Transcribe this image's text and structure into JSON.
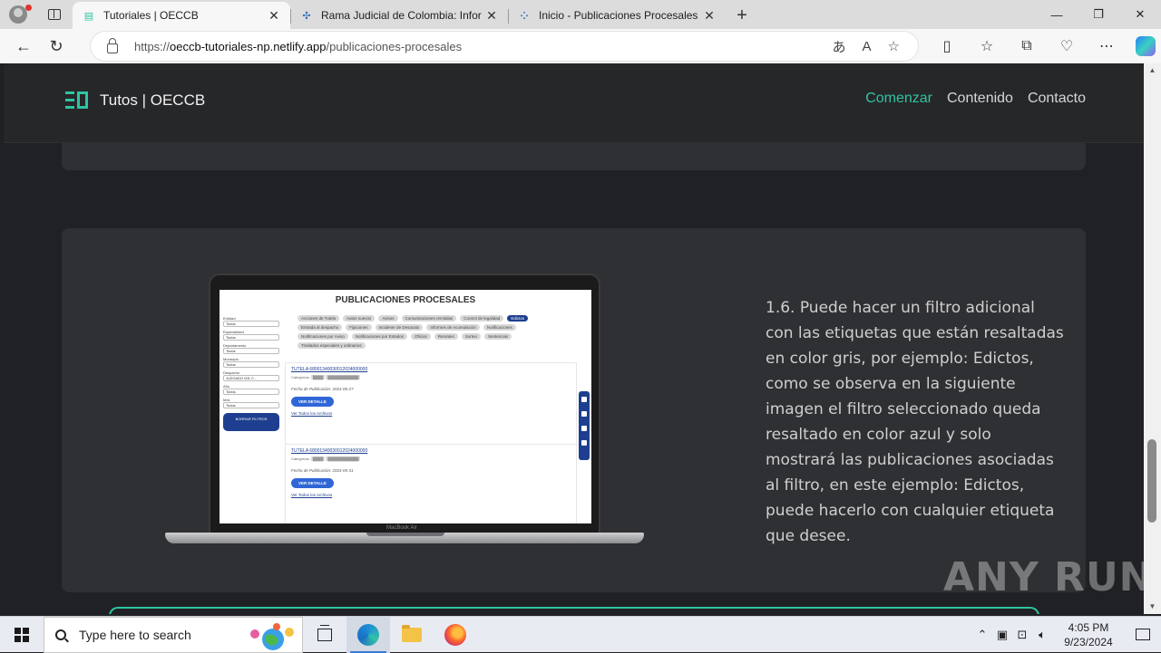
{
  "browser": {
    "tabs": [
      {
        "title": "Tutoriales | OECCB",
        "active": true,
        "favicon": "oeccb-logo-icon"
      },
      {
        "title": "Rama Judicial de Colombia: Infor",
        "active": false,
        "favicon": "rama-judicial-icon"
      },
      {
        "title": "Inicio - Publicaciones Procesales",
        "active": false,
        "favicon": "publicaciones-icon"
      }
    ],
    "url_prefix": "https://",
    "url_host": "oeccb-tutoriales-np.netlify.app",
    "url_path": "/publicaciones-procesales",
    "new_tab_glyph": "+"
  },
  "site": {
    "brand": "Tutos | OECCB",
    "nav": [
      {
        "label": "Comenzar",
        "active": true
      },
      {
        "label": "Contenido",
        "active": false
      },
      {
        "label": "Contacto",
        "active": false
      }
    ],
    "accent_color": "#2ec4a1"
  },
  "step": {
    "text": "1.6. Puede hacer un filtro adicional con las etiquetas que están resaltadas en color gris, por ejemplo: Edictos, como se observa en la siguiente imagen el filtro seleccionado queda resaltado en color azul y solo mostrará las publicaciones asociadas al filtro, en este ejemplo: Edictos, puede hacerlo con cualquier etiqueta que desee."
  },
  "screenshot": {
    "title": "PUBLICACIONES PROCESALES",
    "filters": [
      {
        "label": "Entidad",
        "value": "Todos"
      },
      {
        "label": "Especialidad",
        "value": "Todos"
      },
      {
        "label": "Departamento",
        "value": "Todos"
      },
      {
        "label": "Municipio",
        "value": "Todos"
      },
      {
        "label": "Despacho",
        "value": "JUZGADO 001 C..."
      },
      {
        "label": "Año",
        "value": "Todos"
      },
      {
        "label": "Mes",
        "value": "Todos"
      }
    ],
    "clear_button": "BORRAR FILTROS",
    "tags": [
      {
        "label": "Acciones de Tutela",
        "selected": false
      },
      {
        "label": "Autos nuevos",
        "selected": false
      },
      {
        "label": "Avisos",
        "selected": false
      },
      {
        "label": "Comunicaciones remitidas",
        "selected": false
      },
      {
        "label": "Control de legalidad",
        "selected": false
      },
      {
        "label": "Edictos",
        "selected": true
      },
      {
        "label": "Entrada al despacho",
        "selected": false
      },
      {
        "label": "Fijaciones",
        "selected": false
      },
      {
        "label": "Incidente de Desacato",
        "selected": false
      },
      {
        "label": "Informes de Acumulación",
        "selected": false
      },
      {
        "label": "Notificaciones",
        "selected": false
      },
      {
        "label": "Notificaciones por Aviso",
        "selected": false
      },
      {
        "label": "Notificaciones por Estados",
        "selected": false
      },
      {
        "label": "Oficios",
        "selected": false
      },
      {
        "label": "Remates",
        "selected": false
      },
      {
        "label": "Sorteo",
        "selected": false
      },
      {
        "label": "Sentencias",
        "selected": false
      },
      {
        "label": "Traslados especiales y ordinarios",
        "selected": false
      }
    ],
    "results": [
      {
        "title": "TUTELA 68001340030012024000000",
        "categories_label": "Categorías:",
        "date_label": "Fecha de Publicación:",
        "date": "2024-06-27",
        "button": "VER DETALLE",
        "link": "Ver Todos los Archivos"
      },
      {
        "title": "TUTELA 68001340030012024000000",
        "categories_label": "Categorías:",
        "date_label": "Fecha de Publicación:",
        "date": "2024-05-31",
        "button": "VER DETALLE",
        "link": "Ver Todos los Archivos"
      }
    ],
    "device_label": "MacBook Air"
  },
  "watermark": "ANY RUN",
  "taskbar": {
    "search_placeholder": "Type here to search",
    "time": "4:05 PM",
    "date": "9/23/2024"
  }
}
